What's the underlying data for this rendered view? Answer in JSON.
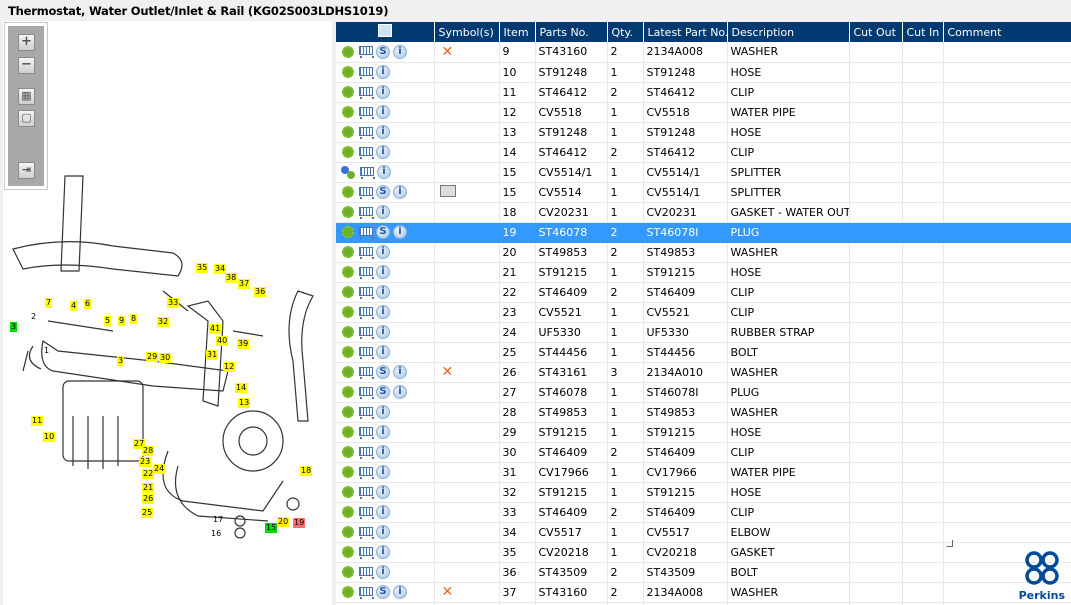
{
  "title": "Thermostat, Water Outlet/Inlet & Rail (KG02S003LDHS1019)",
  "toolbar": {
    "zoom_in": "+",
    "zoom_out": "−",
    "fit": "▦",
    "actual": "▢",
    "side": "⇥"
  },
  "columns": [
    "",
    "Symbol(s)",
    "Item",
    "Parts No.",
    "Qty.",
    "Latest Part No.",
    "Description",
    "Cut Out",
    "Cut In",
    "Comment"
  ],
  "rows": [
    {
      "gear": "green",
      "s": true,
      "sym": "x",
      "item": "9",
      "part": "ST43160",
      "qty": "2",
      "latest": "2134A008",
      "desc": "WASHER"
    },
    {
      "gear": "green",
      "s": false,
      "sym": "",
      "item": "10",
      "part": "ST91248",
      "qty": "1",
      "latest": "ST91248",
      "desc": "HOSE"
    },
    {
      "gear": "green",
      "s": false,
      "sym": "",
      "item": "11",
      "part": "ST46412",
      "qty": "2",
      "latest": "ST46412",
      "desc": "CLIP"
    },
    {
      "gear": "green",
      "s": false,
      "sym": "",
      "item": "12",
      "part": "CV5518",
      "qty": "1",
      "latest": "CV5518",
      "desc": "WATER PIPE"
    },
    {
      "gear": "green",
      "s": false,
      "sym": "",
      "item": "13",
      "part": "ST91248",
      "qty": "1",
      "latest": "ST91248",
      "desc": "HOSE"
    },
    {
      "gear": "green",
      "s": false,
      "sym": "",
      "item": "14",
      "part": "ST46412",
      "qty": "2",
      "latest": "ST46412",
      "desc": "CLIP"
    },
    {
      "gear": "multi",
      "s": false,
      "sym": "",
      "item": "15",
      "part": "CV5514/1",
      "qty": "1",
      "latest": "CV5514/1",
      "desc": "SPLITTER"
    },
    {
      "gear": "green",
      "s": true,
      "sym": "book",
      "item": "15",
      "part": "CV5514",
      "qty": "1",
      "latest": "CV5514/1",
      "desc": "SPLITTER"
    },
    {
      "gear": "green",
      "s": false,
      "sym": "",
      "item": "18",
      "part": "CV20231",
      "qty": "1",
      "latest": "CV20231",
      "desc": "GASKET - WATER OUTLE"
    },
    {
      "gear": "green",
      "s": true,
      "sym": "",
      "item": "19",
      "part": "ST46078",
      "qty": "2",
      "latest": "ST46078I",
      "desc": "PLUG",
      "selected": true
    },
    {
      "gear": "green",
      "s": false,
      "sym": "",
      "item": "20",
      "part": "ST49853",
      "qty": "2",
      "latest": "ST49853",
      "desc": "WASHER"
    },
    {
      "gear": "green",
      "s": false,
      "sym": "",
      "item": "21",
      "part": "ST91215",
      "qty": "1",
      "latest": "ST91215",
      "desc": "HOSE"
    },
    {
      "gear": "green",
      "s": false,
      "sym": "",
      "item": "22",
      "part": "ST46409",
      "qty": "2",
      "latest": "ST46409",
      "desc": "CLIP"
    },
    {
      "gear": "green",
      "s": false,
      "sym": "",
      "item": "23",
      "part": "CV5521",
      "qty": "1",
      "latest": "CV5521",
      "desc": "CLIP"
    },
    {
      "gear": "green",
      "s": false,
      "sym": "",
      "item": "24",
      "part": "UF5330",
      "qty": "1",
      "latest": "UF5330",
      "desc": "RUBBER STRAP"
    },
    {
      "gear": "green",
      "s": false,
      "sym": "",
      "item": "25",
      "part": "ST44456",
      "qty": "1",
      "latest": "ST44456",
      "desc": "BOLT"
    },
    {
      "gear": "green",
      "s": true,
      "sym": "x",
      "item": "26",
      "part": "ST43161",
      "qty": "3",
      "latest": "2134A010",
      "desc": "WASHER"
    },
    {
      "gear": "green",
      "s": true,
      "sym": "",
      "item": "27",
      "part": "ST46078",
      "qty": "1",
      "latest": "ST46078I",
      "desc": "PLUG"
    },
    {
      "gear": "green",
      "s": false,
      "sym": "",
      "item": "28",
      "part": "ST49853",
      "qty": "1",
      "latest": "ST49853",
      "desc": "WASHER"
    },
    {
      "gear": "green",
      "s": false,
      "sym": "",
      "item": "29",
      "part": "ST91215",
      "qty": "1",
      "latest": "ST91215",
      "desc": "HOSE"
    },
    {
      "gear": "green",
      "s": false,
      "sym": "",
      "item": "30",
      "part": "ST46409",
      "qty": "2",
      "latest": "ST46409",
      "desc": "CLIP"
    },
    {
      "gear": "green",
      "s": false,
      "sym": "",
      "item": "31",
      "part": "CV17966",
      "qty": "1",
      "latest": "CV17966",
      "desc": "WATER PIPE"
    },
    {
      "gear": "green",
      "s": false,
      "sym": "",
      "item": "32",
      "part": "ST91215",
      "qty": "1",
      "latest": "ST91215",
      "desc": "HOSE"
    },
    {
      "gear": "green",
      "s": false,
      "sym": "",
      "item": "33",
      "part": "ST46409",
      "qty": "2",
      "latest": "ST46409",
      "desc": "CLIP"
    },
    {
      "gear": "green",
      "s": false,
      "sym": "",
      "item": "34",
      "part": "CV5517",
      "qty": "1",
      "latest": "CV5517",
      "desc": "ELBOW"
    },
    {
      "gear": "green",
      "s": false,
      "sym": "",
      "item": "35",
      "part": "CV20218",
      "qty": "1",
      "latest": "CV20218",
      "desc": "GASKET"
    },
    {
      "gear": "green",
      "s": false,
      "sym": "",
      "item": "36",
      "part": "ST43509",
      "qty": "2",
      "latest": "ST43509",
      "desc": "BOLT"
    },
    {
      "gear": "green",
      "s": true,
      "sym": "x",
      "item": "37",
      "part": "ST43160",
      "qty": "2",
      "latest": "2134A008",
      "desc": "WASHER"
    }
  ],
  "callouts": [
    "35",
    "34",
    "38",
    "37",
    "36",
    "33",
    "32",
    "7",
    "4",
    "6",
    "5",
    "9",
    "8",
    "3",
    "2",
    "1",
    "41",
    "40",
    "39",
    "12",
    "29",
    "30",
    "31",
    "3",
    "14",
    "13",
    "11",
    "10",
    "27",
    "28",
    "23",
    "24",
    "22",
    "21",
    "26",
    "25",
    "18",
    "20",
    "19",
    "15",
    "17",
    "16"
  ],
  "logo": "Perkins",
  "colors": {
    "header": "#003a70",
    "selected": "#3399ff",
    "callout": "#ffff00"
  }
}
